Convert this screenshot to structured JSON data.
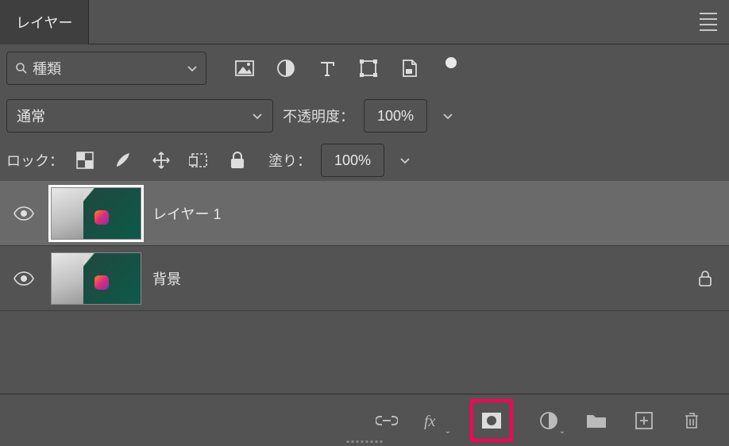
{
  "panel": {
    "title": "レイヤー"
  },
  "filter": {
    "placeholder": "種類"
  },
  "blend": {
    "mode": "通常",
    "opacity_label": "不透明度：",
    "opacity_value": "100%"
  },
  "lock": {
    "label": "ロック：",
    "fill_label": "塗り：",
    "fill_value": "100%"
  },
  "layers": [
    {
      "name": "レイヤー 1",
      "locked": false,
      "selected": true
    },
    {
      "name": "背景",
      "locked": true,
      "selected": false
    }
  ]
}
